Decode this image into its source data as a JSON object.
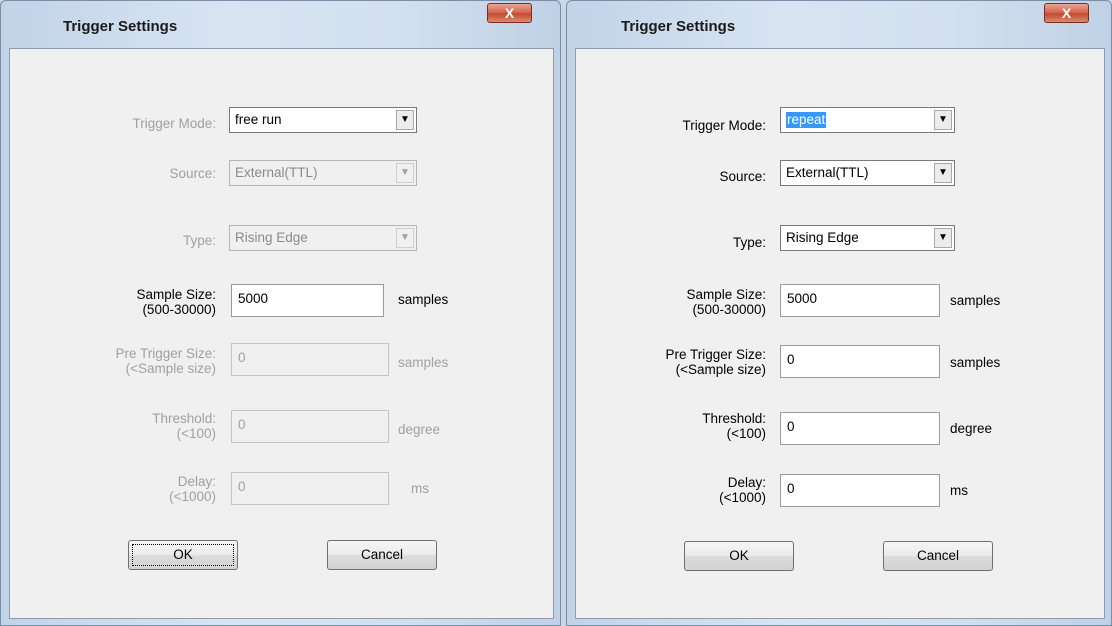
{
  "dialogs": [
    {
      "title": "Trigger Settings",
      "close_glyph": "X",
      "trigger_mode": {
        "label": "Trigger Mode:",
        "value": "free run"
      },
      "source": {
        "label": "Source:",
        "value": "External(TTL)"
      },
      "type": {
        "label": "Type:",
        "value": "Rising Edge"
      },
      "sample_size": {
        "label1": "Sample Size:",
        "label2": "(500-30000)",
        "value": "5000",
        "unit": "samples"
      },
      "pre_trigger": {
        "label1": "Pre Trigger Size:",
        "label2": "(<Sample size)",
        "value": "0",
        "unit": "samples"
      },
      "threshold": {
        "label1": "Threshold:",
        "label2": "(<100)",
        "value": "0",
        "unit": "degree"
      },
      "delay": {
        "label1": "Delay:",
        "label2": "(<1000)",
        "value": "0",
        "unit": "ms"
      },
      "ok_label": "OK",
      "cancel_label": "Cancel"
    },
    {
      "title": "Trigger Settings",
      "close_glyph": "X",
      "trigger_mode": {
        "label": "Trigger Mode:",
        "value": "repeat"
      },
      "source": {
        "label": "Source:",
        "value": "External(TTL)"
      },
      "type": {
        "label": "Type:",
        "value": "Rising Edge"
      },
      "sample_size": {
        "label1": "Sample Size:",
        "label2": "(500-30000)",
        "value": "5000",
        "unit": "samples"
      },
      "pre_trigger": {
        "label1": "Pre Trigger Size:",
        "label2": "(<Sample size)",
        "value": "0",
        "unit": "samples"
      },
      "threshold": {
        "label1": "Threshold:",
        "label2": "(<100)",
        "value": "0",
        "unit": "degree"
      },
      "delay": {
        "label1": "Delay:",
        "label2": "(<1000)",
        "value": "0",
        "unit": "ms"
      },
      "ok_label": "OK",
      "cancel_label": "Cancel"
    }
  ],
  "icons": {
    "dropdown_arrow": "chevron-down-icon",
    "close": "close-icon"
  }
}
